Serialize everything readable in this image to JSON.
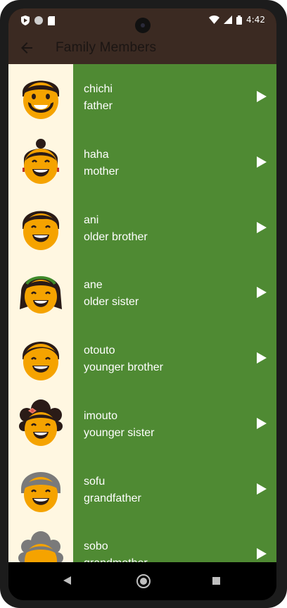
{
  "status": {
    "time": "4:42"
  },
  "appbar": {
    "title": "Family Members",
    "back_icon": "arrow-back-icon"
  },
  "list": {
    "items": [
      {
        "primary": "chichi",
        "secondary": "father",
        "icon": "father-face-icon"
      },
      {
        "primary": "haha",
        "secondary": "mother",
        "icon": "mother-face-icon"
      },
      {
        "primary": "ani",
        "secondary": "older brother",
        "icon": "older-brother-face-icon"
      },
      {
        "primary": "ane",
        "secondary": "older sister",
        "icon": "older-sister-face-icon"
      },
      {
        "primary": "otouto",
        "secondary": "younger brother",
        "icon": "younger-brother-face-icon"
      },
      {
        "primary": "imouto",
        "secondary": "younger sister",
        "icon": "younger-sister-face-icon"
      },
      {
        "primary": "sofu",
        "secondary": "grandfather",
        "icon": "grandfather-face-icon"
      },
      {
        "primary": "sobo",
        "secondary": "grandmother",
        "icon": "grandmother-face-icon"
      }
    ]
  },
  "colors": {
    "list_bg": "#4f8a33",
    "thumb_bg": "#fff7e1",
    "appbar_bg": "#3b2a22",
    "face": "#f5a300",
    "hair_dark": "#2a1b17",
    "hair_grey": "#7a7a7a"
  }
}
